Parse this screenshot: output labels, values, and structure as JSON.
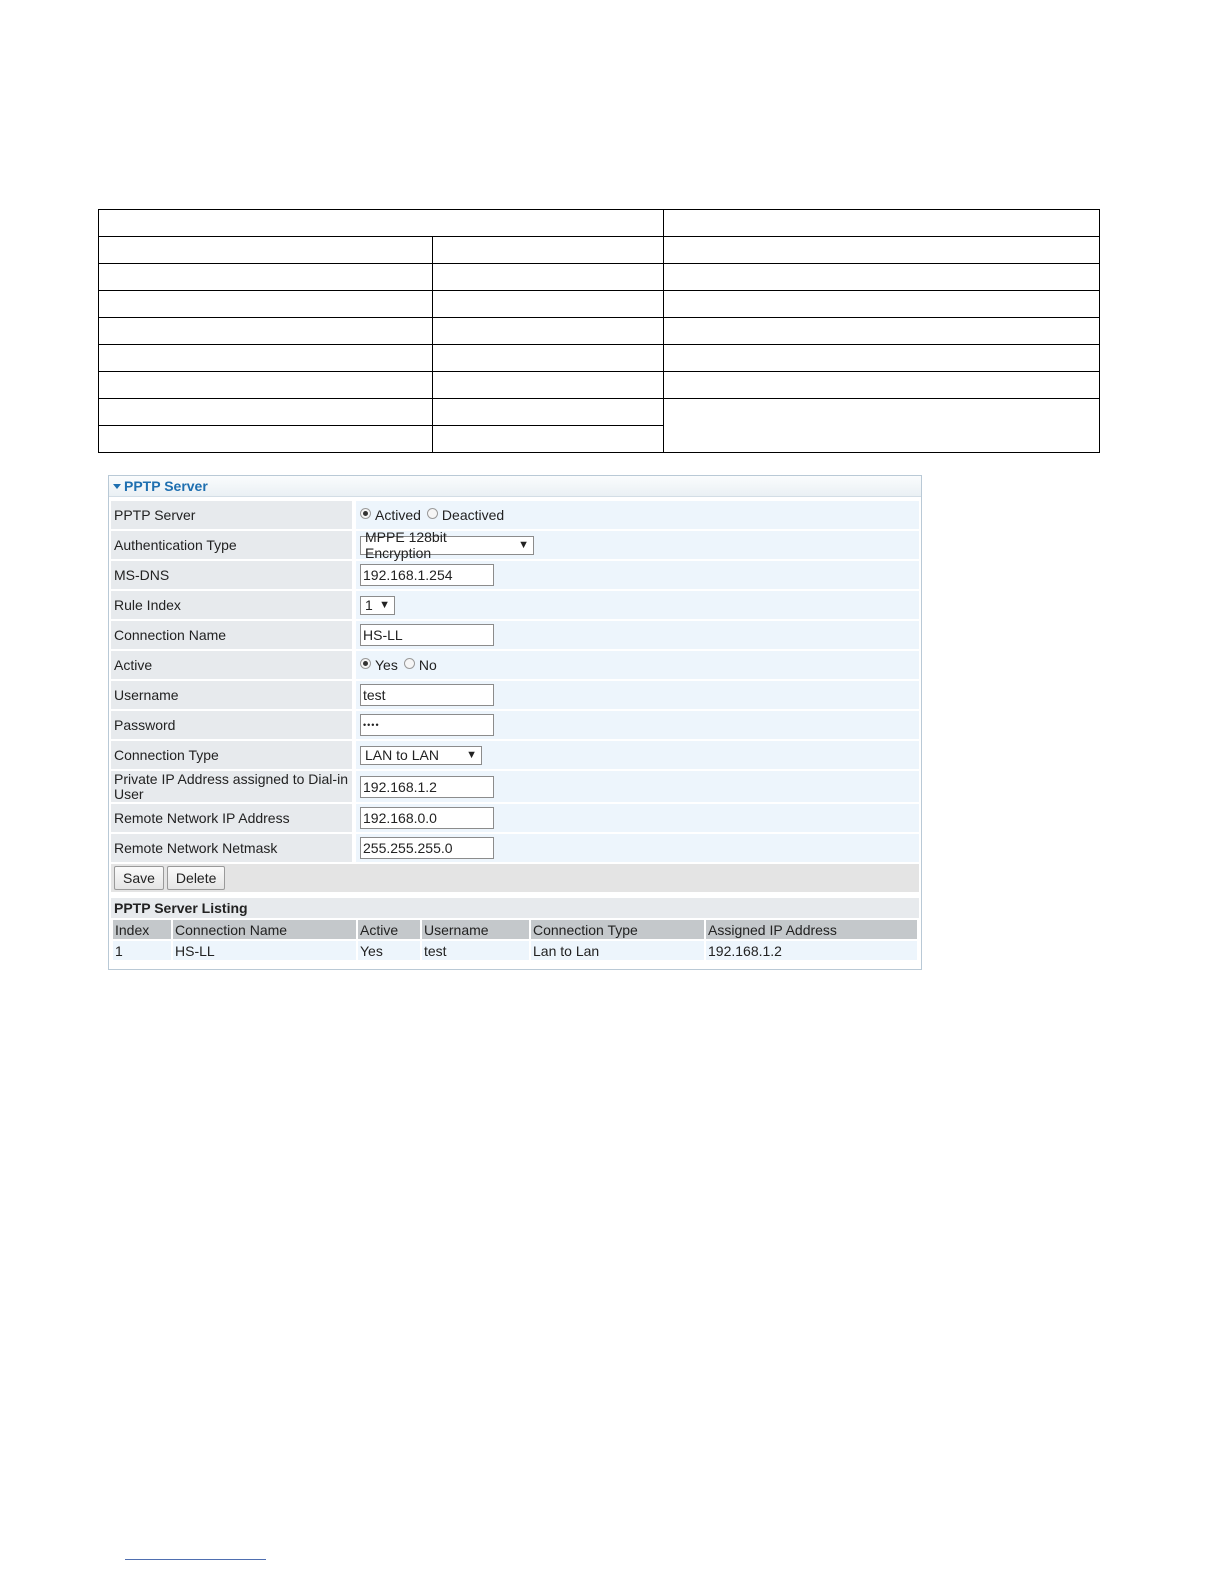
{
  "panel": {
    "title": "PPTP Server"
  },
  "form": {
    "pptp_server": {
      "label": "PPTP Server",
      "options": [
        "Actived",
        "Deactived"
      ],
      "selected": "Actived"
    },
    "auth_type": {
      "label": "Authentication Type",
      "value": "MPPE 128bit Encryption"
    },
    "ms_dns": {
      "label": "MS-DNS",
      "value": "192.168.1.254"
    },
    "rule_index": {
      "label": "Rule Index",
      "value": "1"
    },
    "connection_name": {
      "label": "Connection Name",
      "value": "HS-LL"
    },
    "active": {
      "label": "Active",
      "options": [
        "Yes",
        "No"
      ],
      "selected": "Yes"
    },
    "username": {
      "label": "Username",
      "value": "test"
    },
    "password": {
      "label": "Password",
      "value": "••••"
    },
    "connection_type": {
      "label": "Connection Type",
      "value": "LAN to LAN"
    },
    "private_ip": {
      "label": "Private IP Address assigned to Dial-in User",
      "value": "192.168.1.2"
    },
    "remote_ip": {
      "label": "Remote Network IP Address",
      "value": "192.168.0.0"
    },
    "remote_netmask": {
      "label": "Remote Network Netmask",
      "value": "255.255.255.0"
    }
  },
  "buttons": {
    "save": "Save",
    "delete": "Delete"
  },
  "listing": {
    "title": "PPTP Server Listing",
    "headers": [
      "Index",
      "Connection Name",
      "Active",
      "Username",
      "Connection Type",
      "Assigned IP Address"
    ],
    "rows": [
      [
        "1",
        "HS-LL",
        "Yes",
        "test",
        "Lan to Lan",
        "192.168.1.2"
      ]
    ]
  }
}
